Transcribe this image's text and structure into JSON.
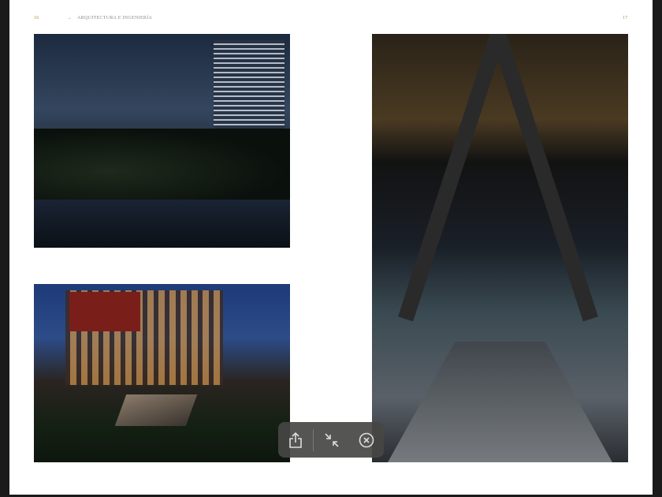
{
  "header": {
    "left_page_number": "16",
    "arrow": "→",
    "section_title": "ARQUITECTURA E INGENIERÍA",
    "right_page_number": "17"
  },
  "photos": [
    {
      "subject": "night-towers-reflecting-pool"
    },
    {
      "subject": "glass-building-garden-bench"
    },
    {
      "subject": "steel-structure-glass-bridge"
    }
  ],
  "toolbar": {
    "icons": [
      "share-icon",
      "minimize-icon",
      "close-icon"
    ]
  }
}
